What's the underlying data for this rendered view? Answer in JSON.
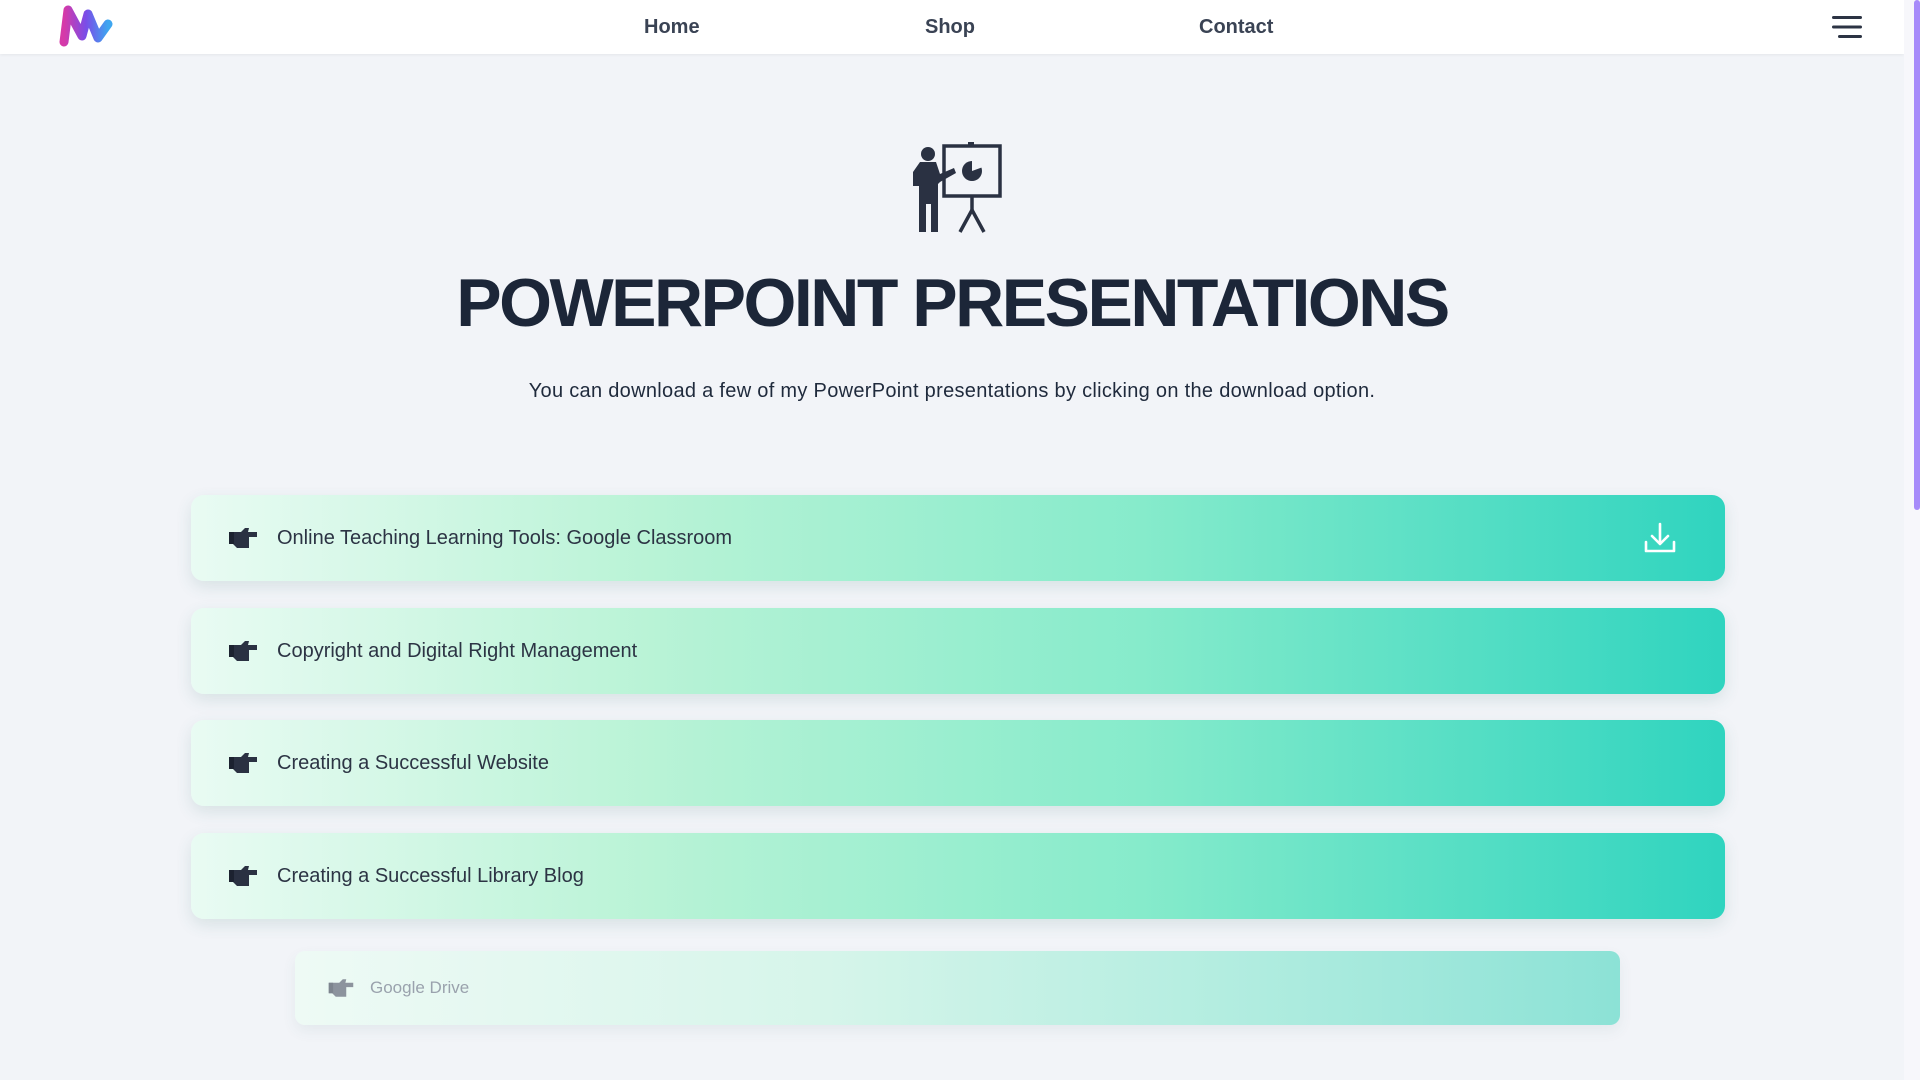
{
  "nav": {
    "links": [
      "Home",
      "Shop",
      "Contact"
    ]
  },
  "hero": {
    "icon": "presentation-icon",
    "title": "POWERPOINT PRESENTATIONS",
    "subtitle": "You can download a few of my PowerPoint presentations by clicking on the download option."
  },
  "items": [
    {
      "label": "Online Teaching Learning Tools: Google Classroom",
      "icon": "pointing-hand-icon",
      "action_icon": "download-icon"
    },
    {
      "label": "Copyright and Digital Right Management",
      "icon": "pointing-hand-icon"
    },
    {
      "label": "Creating a Successful Website",
      "icon": "pointing-hand-icon"
    },
    {
      "label": "Creating a Successful Library Blog",
      "icon": "pointing-hand-icon"
    },
    {
      "label": "Google Drive",
      "icon": "pointing-hand-icon"
    }
  ],
  "colors": {
    "accent_start": "#e9fbf3",
    "accent_end": "#2fd4bf",
    "title": "#1c2638",
    "scrollbar": "#a78bfa"
  }
}
